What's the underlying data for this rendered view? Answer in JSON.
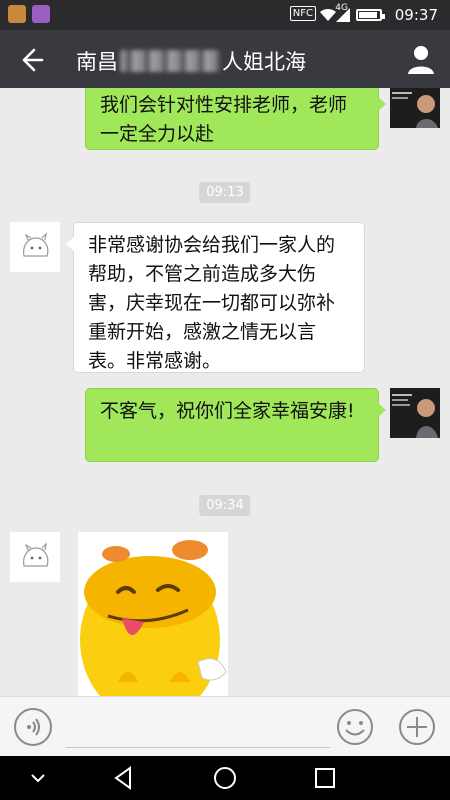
{
  "status_bar": {
    "time": "09:37",
    "network": "4G",
    "nfc": "NFC",
    "battery_level": 0.9,
    "icons": [
      "app-notification-icon",
      "app-notification-icon-2",
      "nfc-icon",
      "wifi-icon",
      "signal-icon",
      "battery-icon"
    ]
  },
  "header": {
    "title_prefix": "南昌",
    "title_suffix": "人姐北海",
    "back_icon": "back-arrow-icon",
    "profile_icon": "person-icon"
  },
  "messages": [
    {
      "side": "out",
      "text": "我们会针对性安排老师，老师一定全力以赴"
    },
    {
      "type": "time",
      "text": "09:13"
    },
    {
      "side": "in",
      "text": "非常感谢协会给我们一家人的帮助，不管之前造成多大伤害，庆幸现在一切都可以弥补重新开始，感激之情无以言表。非常感谢。"
    },
    {
      "side": "out",
      "text": "不客气，祝你们全家幸福安康!"
    },
    {
      "type": "time",
      "text": "09:34"
    },
    {
      "side": "in",
      "type": "sticker",
      "sticker": "smiling-yellow-character-sticker"
    }
  ],
  "input": {
    "placeholder": "",
    "voice_icon": "voice-icon",
    "emoji_icon": "emoji-icon",
    "plus_icon": "plus-icon"
  },
  "nav": [
    "back-triangle-icon",
    "home-circle-icon",
    "recent-square-icon",
    "chevron-down-icon"
  ],
  "colors": {
    "header_bg": "#393a3f",
    "status_bg": "#2b2b2d",
    "chat_bg": "#ebebeb",
    "outgoing_bubble": "#a0e75a",
    "incoming_bubble": "#ffffff"
  }
}
